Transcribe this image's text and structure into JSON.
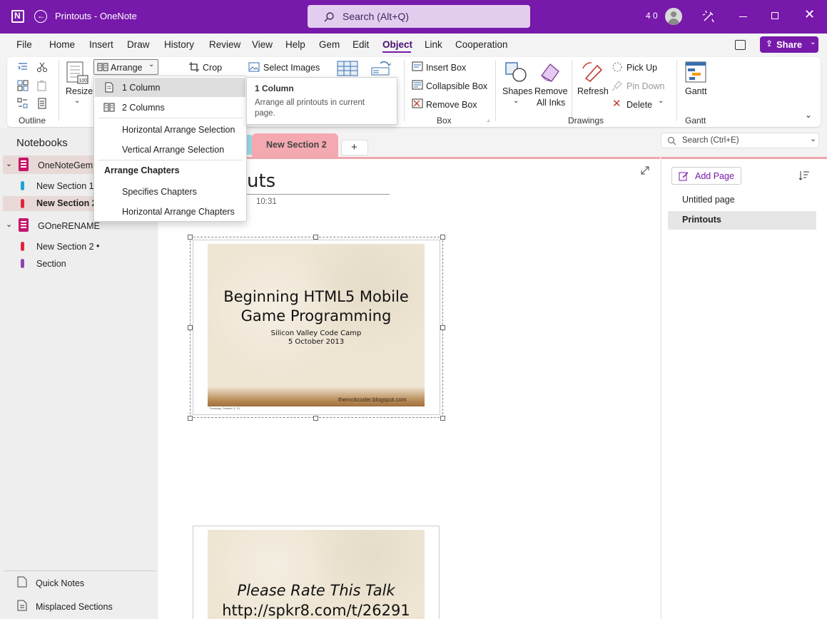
{
  "window": {
    "title": "Printouts - OneNote",
    "search_placeholder": "Search (Alt+Q)",
    "user_count": "4 0"
  },
  "colors": {
    "brand": "#7719aa",
    "section_tab": "#f4a9b1",
    "nav_selected": "#e8d9d6"
  },
  "menu": {
    "items": [
      "File",
      "Home",
      "Insert",
      "Draw",
      "History",
      "Review",
      "View",
      "Help",
      "Gem",
      "Edit",
      "Object",
      "Link",
      "Cooperation"
    ],
    "active": "Object",
    "share": "Share"
  },
  "ribbon": {
    "outline_group": "Outline",
    "resize": "Resize",
    "arrange": "Arrange",
    "crop": "Crop",
    "select_images": "Select Images",
    "insert_box": "Insert Box",
    "collapsible_box": "Collapsible Box",
    "remove_box": "Remove Box",
    "box_group": "Box",
    "shapes": "Shapes",
    "remove_all_inks_1": "Remove",
    "remove_all_inks_2": "All Inks",
    "refresh": "Refresh",
    "pick_up": "Pick Up",
    "pin_down": "Pin Down",
    "delete": "Delete",
    "drawings_group": "Drawings",
    "gantt": "Gantt",
    "gantt_group": "Gantt"
  },
  "arrange_menu": {
    "items": [
      "1 Column",
      "2 Columns",
      "Horizontal Arrange Selection",
      "Vertical Arrange Selection"
    ],
    "header": "Arrange Chapters",
    "chapter_items": [
      "Specifies Chapters",
      "Horizontal Arrange Chapters"
    ]
  },
  "tooltip": {
    "title": "1 Column",
    "body_line1": "Arrange all printouts in current",
    "body_line2": "page."
  },
  "nav": {
    "header": "Notebooks",
    "notebooks": [
      {
        "name": "OneNoteGem",
        "sections": [
          "New Section 1",
          "New Section 2"
        ]
      },
      {
        "name": "GOneRENAME",
        "sections": [
          "New Section 2",
          "Section"
        ]
      }
    ],
    "unsaved_dot": "•",
    "quick_notes": "Quick Notes",
    "misplaced_sections": "Misplaced Sections"
  },
  "sections": {
    "active_tab": "New Section 2",
    "add": "+"
  },
  "page": {
    "title_fragment": "uts",
    "time": "10:31",
    "slide1": {
      "title_line1": "Beginning HTML5 Mobile",
      "title_line2": "Game Programming",
      "sub1": "Silicon Valley Code Camp",
      "sub2": "5 October 2013",
      "footer": "therockcoder.blogspot.com",
      "date_note": "Thursday, October 3, 13"
    },
    "slide2": {
      "line1": "Please Rate This Talk",
      "line2": "http://spkr8.com/t/26291"
    }
  },
  "pages_panel": {
    "search_placeholder": "Search (Ctrl+E)",
    "add_page": "Add Page",
    "pages": [
      "Untitled page",
      "Printouts"
    ]
  }
}
